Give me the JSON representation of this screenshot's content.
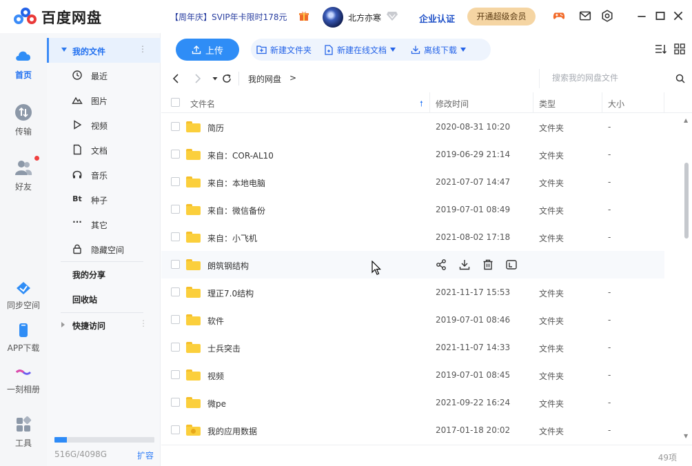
{
  "app": {
    "name": "百度网盘"
  },
  "header": {
    "promo": "【周年庆】SVIP年卡限时178元",
    "username": "北方亦寒",
    "enterprise": "企业认证",
    "super_vip": "开通超级会员",
    "icons": [
      "gift-icon",
      "game-icon",
      "mail-icon",
      "settings-icon",
      "minimize-icon",
      "maximize-icon",
      "close-icon"
    ]
  },
  "rail": {
    "items": [
      {
        "label": "首页",
        "icon": "home-cloud-icon",
        "active": true
      },
      {
        "label": "传输",
        "icon": "transfer-icon"
      },
      {
        "label": "好友",
        "icon": "friends-icon"
      },
      {
        "label": "同步空间",
        "icon": "sync-icon"
      },
      {
        "label": "APP下载",
        "icon": "phone-icon"
      },
      {
        "label": "一刻相册",
        "icon": "album-icon"
      },
      {
        "label": "工具",
        "icon": "tools-icon"
      }
    ]
  },
  "sidebar": {
    "my_files": "我的文件",
    "items": [
      {
        "label": "最近",
        "icon": "clock-icon"
      },
      {
        "label": "图片",
        "icon": "image-icon"
      },
      {
        "label": "视频",
        "icon": "play-icon"
      },
      {
        "label": "文档",
        "icon": "document-icon"
      },
      {
        "label": "音乐",
        "icon": "headphones-icon"
      },
      {
        "label": "种子",
        "icon": "bt-icon",
        "glyph": "Bt"
      },
      {
        "label": "其它",
        "icon": "more-icon",
        "glyph": "···"
      },
      {
        "label": "隐藏空间",
        "icon": "lock-icon"
      }
    ],
    "my_share": "我的分享",
    "recycle": "回收站",
    "quick_access": "快捷访问",
    "storage_text": "516G/4098G",
    "storage_used": 0.126,
    "expand": "扩容"
  },
  "toolbar": {
    "upload": "上传",
    "new_folder": "新建文件夹",
    "new_online_doc": "新建在线文档",
    "offline_download": "离线下载"
  },
  "nav": {
    "breadcrumb": "我的网盘",
    "separator": ">",
    "search_placeholder": "搜索我的网盘文件"
  },
  "table": {
    "headers": {
      "name": "文件名",
      "modified": "修改时间",
      "type": "类型",
      "size": "大小"
    },
    "rows": [
      {
        "name": "简历",
        "time": "2020-08-31 10:20",
        "type": "文件夹",
        "size": "-"
      },
      {
        "name": "来自：COR-AL10",
        "time": "2019-06-29 21:14",
        "type": "文件夹",
        "size": "-"
      },
      {
        "name": "来自：本地电脑",
        "time": "2021-07-07 14:47",
        "type": "文件夹",
        "size": "-"
      },
      {
        "name": "来自：微信备份",
        "time": "2019-07-01 08:49",
        "type": "文件夹",
        "size": "-"
      },
      {
        "name": "来自：小飞机",
        "time": "2021-08-02 17:18",
        "type": "文件夹",
        "size": "-"
      },
      {
        "name": "朗筑钢结构",
        "time": "",
        "type": "",
        "size": "",
        "hover": true
      },
      {
        "name": "理正7.0结构",
        "time": "2021-11-17 15:53",
        "type": "文件夹",
        "size": "-"
      },
      {
        "name": "软件",
        "time": "2019-07-01 08:46",
        "type": "文件夹",
        "size": "-"
      },
      {
        "name": "士兵突击",
        "time": "2021-11-07 14:33",
        "type": "文件夹",
        "size": "-"
      },
      {
        "name": "视频",
        "time": "2019-07-01 08:45",
        "type": "文件夹",
        "size": "-"
      },
      {
        "name": "微pe",
        "time": "2021-09-22 16:24",
        "type": "文件夹",
        "size": "-"
      },
      {
        "name": "我的应用数据",
        "time": "2017-01-18 20:02",
        "type": "文件夹",
        "size": "-",
        "special": true
      }
    ]
  },
  "footer": {
    "count": "49项"
  },
  "colors": {
    "accent": "#2f8df6",
    "folder": "#fbcf3c",
    "promo": "#2a3fa0",
    "vip_btn": "#f5d5a3"
  }
}
